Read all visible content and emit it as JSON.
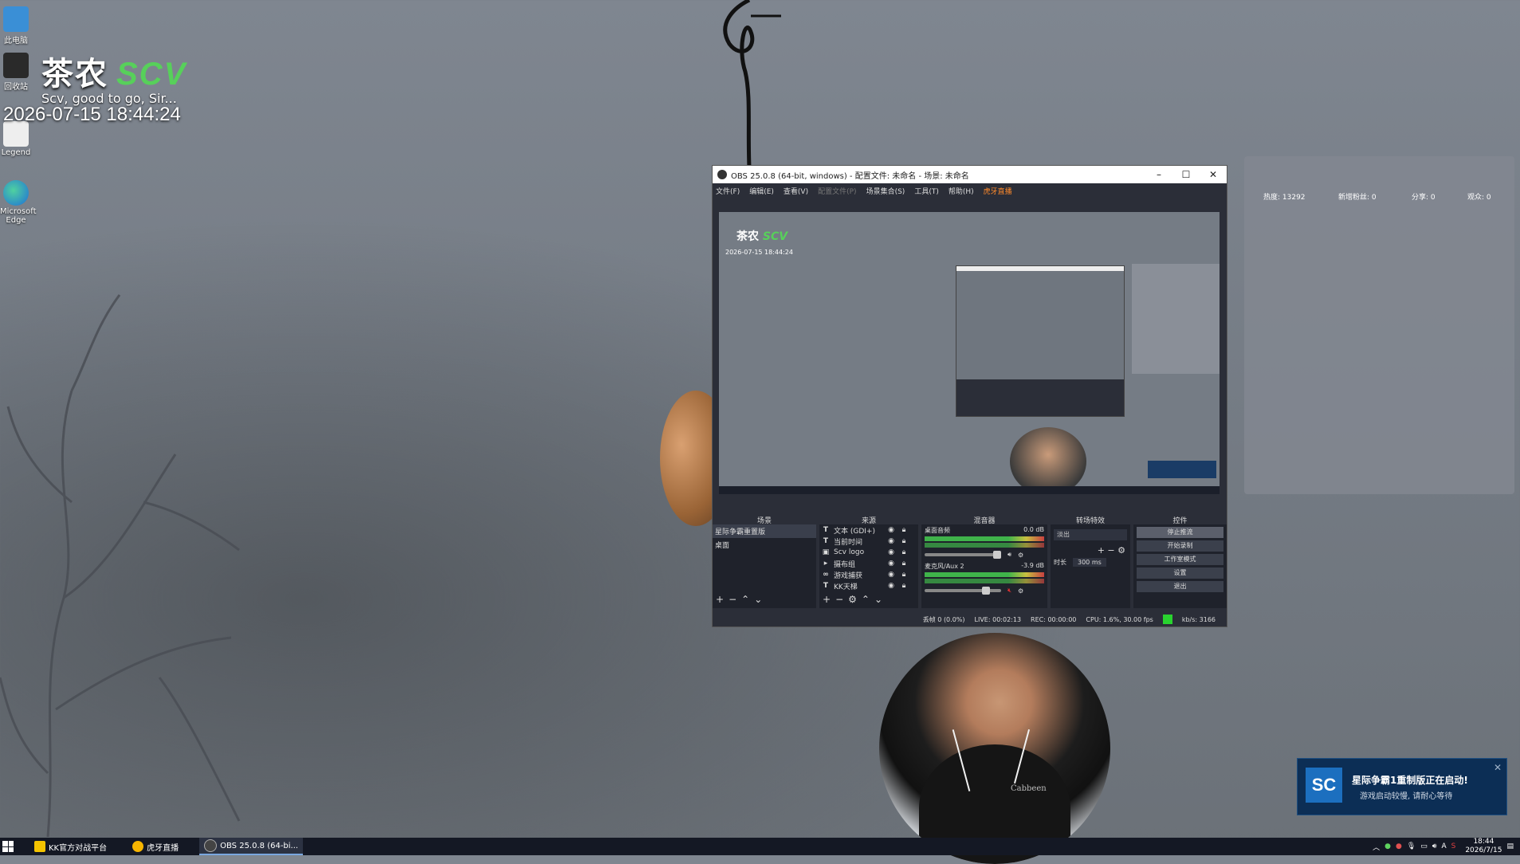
{
  "desktop": {
    "icons": [
      {
        "label": "此电脑"
      },
      {
        "label": "回收站"
      },
      {
        "label": "Legend"
      },
      {
        "label": "Microsoft Edge"
      }
    ],
    "brand_cn": "茶农",
    "brand_scv": "SCV",
    "brand_sub": "Scv,   good to go,   Sir...",
    "datetime": "2026-07-15 18:44:24"
  },
  "obs": {
    "title": "OBS 25.0.8 (64-bit, windows) - 配置文件: 未命名 - 场景: 未命名",
    "menu": [
      "文件(F)",
      "编辑(E)",
      "查看(V)",
      "配置文件(P)",
      "场景集合(S)",
      "工具(T)",
      "帮助(H)",
      "虎牙直播"
    ],
    "preview": {
      "brand_cn": "茶农",
      "brand_scv": "SCV",
      "date": "2026-07-15 18:44:24"
    },
    "docks": {
      "scenes": "场景",
      "sources": "来源",
      "mixer": "混音器",
      "transitions": "转场特效",
      "controls": "控件"
    },
    "scenes": [
      "星际争霸重置版",
      "桌面"
    ],
    "sources": [
      {
        "icon": "T",
        "name": "文本 (GDI+)"
      },
      {
        "icon": "T",
        "name": "当前时间"
      },
      {
        "icon": "▣",
        "name": "Scv logo"
      },
      {
        "icon": "▸",
        "name": "摄布组"
      },
      {
        "icon": "∞",
        "name": "游戏捕获"
      },
      {
        "icon": "T",
        "name": "KK天梯"
      }
    ],
    "mixer": [
      {
        "name": "桌面音频",
        "db": "0.0 dB"
      },
      {
        "name": "麦克风/Aux 2",
        "db": "-3.9 dB"
      }
    ],
    "transition": {
      "select": "淡出",
      "duration_label": "时长",
      "duration": "300 ms"
    },
    "controls": [
      "停止推流",
      "开始录制",
      "工作室模式",
      "设置",
      "退出"
    ],
    "status": {
      "dropped": "丢帧 0 (0.0%)",
      "live": "LIVE: 00:02:13",
      "rec": "REC: 00:00:00",
      "cpu": "CPU: 1.6%, 30.00 fps",
      "kbps": "kb/s: 3166"
    }
  },
  "stats": {
    "heat": "热度: 13292",
    "new_fans": "新增粉丝: 0",
    "shares": "分享: 0",
    "viewers": "观众: 0"
  },
  "webcam": {
    "shirt_text": "Cabbeen"
  },
  "notification": {
    "logo": "SC",
    "title": "星际争霸1重制版正在启动!",
    "body": "游戏启动较慢, 请耐心等待"
  },
  "taskbar": {
    "apps": [
      {
        "label": "KK官方对战平台"
      },
      {
        "label": "虎牙直播"
      },
      {
        "label": "OBS 25.0.8 (64-bi..."
      }
    ],
    "time": "18:44",
    "date": "2026/7/15"
  }
}
